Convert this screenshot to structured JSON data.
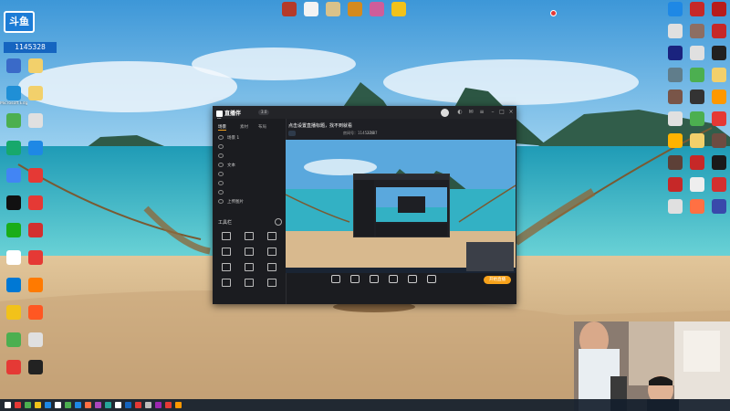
{
  "desktop": {
    "brand": {
      "logo_text": "斗鱼",
      "counter": "1145328"
    },
    "top_icons": [
      {
        "label": "",
        "color": "#b53a2a"
      },
      {
        "label": "",
        "color": "#f3f3f3"
      },
      {
        "label": "",
        "color": "#d9c28a"
      },
      {
        "label": "",
        "color": "#d48a1e"
      },
      {
        "label": "",
        "color": "#cf5d9a"
      },
      {
        "label": "",
        "color": "#f2c21a"
      }
    ],
    "left_icons": [
      {
        "label": "",
        "color": "#3a6ac8"
      },
      {
        "label": "",
        "color": "#f2d06b"
      },
      {
        "label": "Microsoft Edge",
        "color": "#1f8fd6"
      },
      {
        "label": "",
        "color": "#f2d06b"
      },
      {
        "label": "",
        "color": "#4caf50"
      },
      {
        "label": "",
        "color": "#e0e0e0"
      },
      {
        "label": "",
        "color": "#17a86b"
      },
      {
        "label": "",
        "color": "#1e88e5"
      },
      {
        "label": "",
        "color": "#4285f4"
      },
      {
        "label": "",
        "color": "#e53935"
      },
      {
        "label": "",
        "color": "#111111"
      },
      {
        "label": "",
        "color": "#e53935"
      },
      {
        "label": "",
        "color": "#1aad19"
      },
      {
        "label": "",
        "color": "#d32f2f"
      },
      {
        "label": "",
        "color": "#ffffff"
      },
      {
        "label": "",
        "color": "#e53935"
      },
      {
        "label": "",
        "color": "#0078d4"
      },
      {
        "label": "",
        "color": "#ff7a00"
      },
      {
        "label": "",
        "color": "#f2c21a"
      },
      {
        "label": "",
        "color": "#ff5722"
      },
      {
        "label": "",
        "color": "#4caf50"
      },
      {
        "label": "",
        "color": "#e0e0e0"
      },
      {
        "label": "",
        "color": "#e53935"
      },
      {
        "label": "",
        "color": "#222222"
      }
    ],
    "right_icons": [
      {
        "label": "",
        "color": "#1e88e5"
      },
      {
        "label": "",
        "color": "#c62828"
      },
      {
        "label": "",
        "color": "#b71c1c"
      },
      {
        "label": "",
        "color": "#e0e0e0"
      },
      {
        "label": "",
        "color": "#8d6e63"
      },
      {
        "label": "",
        "color": "#c62828"
      },
      {
        "label": "",
        "color": "#1a237e"
      },
      {
        "label": "",
        "color": "#e0e0e0"
      },
      {
        "label": "",
        "color": "#212121"
      },
      {
        "label": "",
        "color": "#607d8b"
      },
      {
        "label": "",
        "color": "#4caf50"
      },
      {
        "label": "",
        "color": "#f2d06b"
      },
      {
        "label": "",
        "color": "#795548"
      },
      {
        "label": "",
        "color": "#333333"
      },
      {
        "label": "",
        "color": "#ff9800"
      },
      {
        "label": "",
        "color": "#e0e0e0"
      },
      {
        "label": "",
        "color": "#4caf50"
      },
      {
        "label": "",
        "color": "#e53935"
      },
      {
        "label": "",
        "color": "#ffb300"
      },
      {
        "label": "",
        "color": "#f2d06b"
      },
      {
        "label": "",
        "color": "#6d4c41"
      },
      {
        "label": "",
        "color": "#5d4037"
      },
      {
        "label": "",
        "color": "#c62828"
      },
      {
        "label": "",
        "color": "#1a1a1a"
      },
      {
        "label": "",
        "color": "#c62828"
      },
      {
        "label": "",
        "color": "#eeeeee"
      },
      {
        "label": "",
        "color": "#d32f2f"
      },
      {
        "label": "",
        "color": "#e0e0e0"
      },
      {
        "label": "",
        "color": "#ff7043"
      },
      {
        "label": "",
        "color": "#3949ab"
      }
    ]
  },
  "app": {
    "name": "直播伴侣",
    "version": "3.0",
    "sidebar": {
      "tabs": [
        "场景",
        "素材",
        "布局"
      ],
      "scenes": [
        "场景 1",
        "",
        "",
        "文本",
        "",
        "",
        "",
        "上传图片"
      ],
      "tools_title": "工具栏",
      "tools": [
        "",
        "",
        "",
        "",
        "",
        "",
        "",
        "",
        "",
        "",
        "",
        ""
      ],
      "footer": ""
    },
    "header": {
      "stream_title": "点击设置直播标题，找不到就看",
      "category": "",
      "room_id": "房间号：1145328",
      "viewers": "27/87"
    },
    "toolbar": {
      "items": [
        "",
        "",
        "",
        "",
        "",
        ""
      ],
      "start_live": "开始直播",
      "stats": ""
    }
  },
  "colors": {
    "sky": "#56a9e0",
    "sea": "#2fb3c6",
    "sand": "#d8b98e",
    "accent": "#f7a21b"
  }
}
